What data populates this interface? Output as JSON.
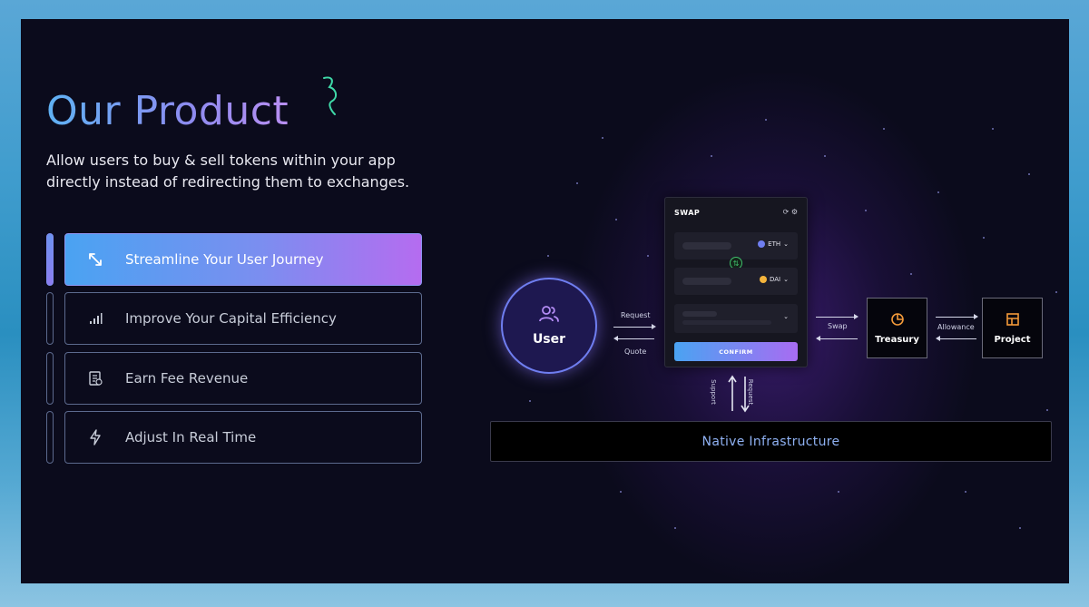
{
  "slide": {
    "title": "Our Product",
    "annotation": "3",
    "subtitle": "Allow users to buy & sell tokens within your app directly instead of redirecting them to exchanges."
  },
  "features": [
    {
      "label": "Streamline Your User Journey",
      "icon": "expand-arrows-icon",
      "active": true
    },
    {
      "label": "Improve Your Capital Efficiency",
      "icon": "bar-chart-icon",
      "active": false
    },
    {
      "label": "Earn Fee Revenue",
      "icon": "receipt-icon",
      "active": false
    },
    {
      "label": "Adjust In Real Time",
      "icon": "lightning-icon",
      "active": false
    }
  ],
  "diagram": {
    "user": {
      "label": "User",
      "icon": "users-icon"
    },
    "request_label": "Request",
    "quote_label": "Quote",
    "swap_label": "Swap",
    "allowance_label": "Allowance",
    "support_label": "Support",
    "request_vertical_label": "Request",
    "swap_card": {
      "title": "SWAP",
      "token_from": "ETH",
      "token_to": "DAI",
      "confirm_label": "CONFIRM"
    },
    "treasury": {
      "label": "Treasury",
      "icon": "pie-chart-icon"
    },
    "project": {
      "label": "Project",
      "icon": "layout-icon"
    },
    "native": {
      "label": "Native Infrastructure"
    }
  },
  "colors": {
    "accent_blue": "#4aa3f2",
    "accent_purple": "#b56cf0",
    "background": "#0b0b1c"
  }
}
